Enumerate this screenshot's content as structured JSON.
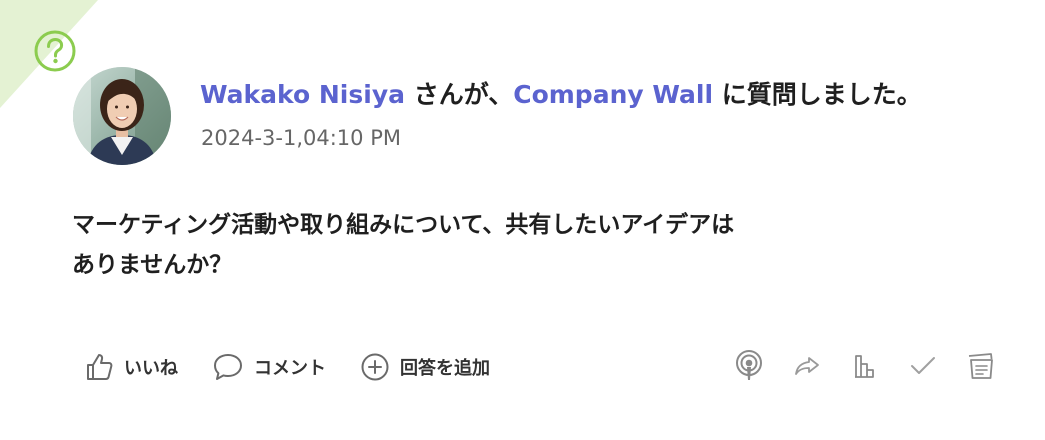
{
  "post": {
    "author": "Wakako Nisiya",
    "connector": "さんが、",
    "target": "Company Wall",
    "suffix": "に質問しました。",
    "timestamp": "2024-3-1,04:10 PM",
    "question_line1": "マーケティング活動や取り組みについて、共有したいアイデアは",
    "question_line2": "ありませんか？"
  },
  "actions": {
    "like": "いいね",
    "comment": "コメント",
    "add_answer": "回答を追加"
  },
  "tools": [
    "broadcast-icon",
    "share-icon",
    "stats-icon",
    "check-icon",
    "notes-icon"
  ],
  "colors": {
    "link": "#5b63cf",
    "corner": "#e4f2d3",
    "corner_icon": "#8ccc4f",
    "icon_gray": "#8a8a8a"
  }
}
